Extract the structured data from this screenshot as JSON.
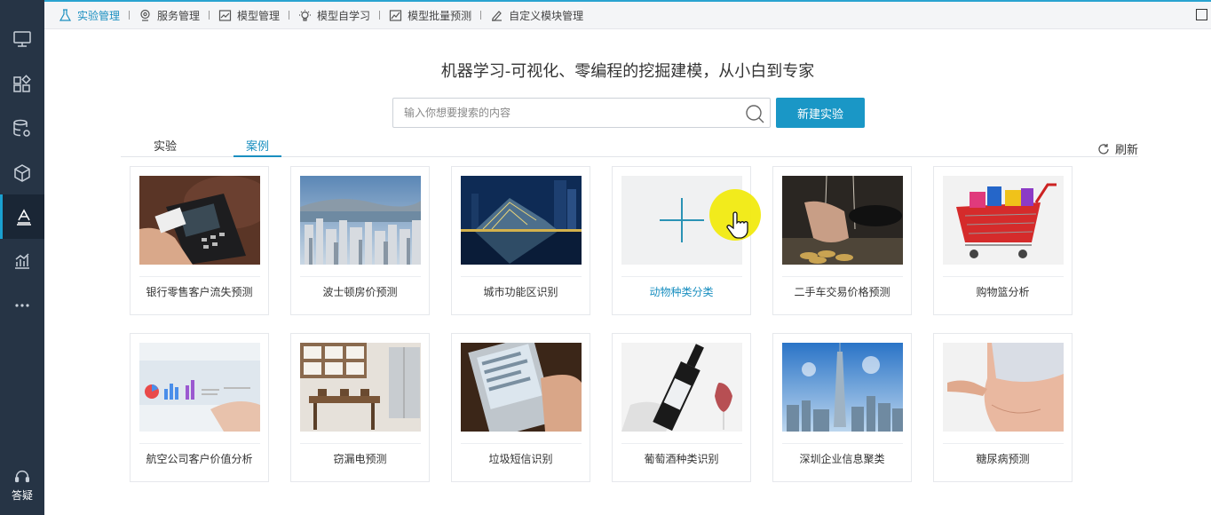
{
  "sidebar": {
    "items": [
      {
        "icon": "monitor-icon"
      },
      {
        "icon": "components-icon"
      },
      {
        "icon": "database-gear-icon"
      },
      {
        "icon": "cube-icon"
      },
      {
        "icon": "experiment-flask-icon",
        "active": true
      },
      {
        "icon": "bar-chart-icon"
      },
      {
        "icon": "more-dots-icon"
      }
    ],
    "help_label": "答疑"
  },
  "topnav": {
    "items": [
      {
        "label": "实验管理",
        "icon": "flask-icon",
        "active": true
      },
      {
        "label": "服务管理",
        "icon": "service-pin-icon"
      },
      {
        "label": "模型管理",
        "icon": "model-chart-icon"
      },
      {
        "label": "模型自学习",
        "icon": "bulb-icon"
      },
      {
        "label": "模型批量预测",
        "icon": "batch-chart-icon"
      },
      {
        "label": "自定义模块管理",
        "icon": "custom-module-icon"
      }
    ]
  },
  "headline": "机器学习-可视化、零编程的挖掘建模，从小白到专家",
  "search": {
    "placeholder": "输入你想要搜索的内容",
    "value": ""
  },
  "new_button": "新建实验",
  "tabs": [
    {
      "label": "实验",
      "active": false
    },
    {
      "label": "案例",
      "active": true
    }
  ],
  "refresh_label": "刷新",
  "cards": [
    {
      "title": "银行零售客户流失预测",
      "image": "pos-terminal"
    },
    {
      "title": "波士顿房价预测",
      "image": "city-harbor"
    },
    {
      "title": "城市功能区识别",
      "image": "opera-house-night"
    },
    {
      "title": "动物种类分类",
      "image": "plus-placeholder",
      "highlight": true
    },
    {
      "title": "二手车交易价格预测",
      "image": "car-key-coins"
    },
    {
      "title": "购物篮分析",
      "image": "shopping-cart"
    },
    {
      "title": "航空公司客户价值分析",
      "image": "charts-hand"
    },
    {
      "title": "窃漏电预测",
      "image": "kitchen-interior"
    },
    {
      "title": "垃圾短信识别",
      "image": "phone-sms"
    },
    {
      "title": "葡萄酒种类识别",
      "image": "wine-bottle"
    },
    {
      "title": "深圳企业信息聚类",
      "image": "shenzhen-skyline"
    },
    {
      "title": "糖尿病预测",
      "image": "belly"
    }
  ]
}
